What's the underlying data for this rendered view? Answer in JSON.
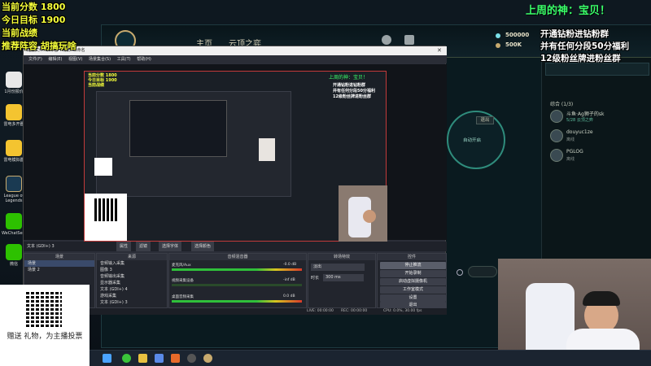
{
  "overlay_left": {
    "score": "当前分数 1800",
    "target": "今日目标 1900",
    "record": "当前战绩",
    "recommend": "推荐阵容 胡搞玩啥"
  },
  "overlay_god": "上周的神：宝贝！",
  "overlay_right": {
    "line1": "开通钻粉进钻粉群",
    "line2": "并有任何分段50分福利",
    "line3": "12级粉丝牌进粉丝群"
  },
  "lol_client": {
    "nav_home": "主页",
    "nav_tft": "云顶之弈",
    "currency_1": "500000",
    "currency_2": "500K",
    "friends_header": "综合 (1/3)",
    "friends": [
      {
        "name": "斗鱼·Ag狮子的sk",
        "status": "5/28 云顶之弈"
      },
      {
        "name": "douyuc1ze",
        "status": "离线"
      },
      {
        "name": "PGLOG",
        "status": "离线"
      }
    ],
    "button_exit": "退出",
    "mode_label": "自动开启"
  },
  "obs": {
    "title": "配置文件: 未命名 - 场景: 未命名",
    "menu": [
      "文件(F)",
      "编辑(E)",
      "视图(V)",
      "场景集合(S)",
      "工具(T)",
      "帮助(H)"
    ],
    "source_name": "文本 (GDI+) 3",
    "toolbar_props": "属性",
    "toolbar_filters": "滤镜",
    "toolbar_text": "选择字体",
    "toolbar_edit": "选择颜色",
    "scenes_header": "场景",
    "scenes": [
      "场景",
      "场景 2"
    ],
    "sources_header": "来源",
    "sources": [
      "音频输入采集",
      "图像 3",
      "音频输出采集",
      "显示器采集",
      "文本 (GDI+) 4",
      "游戏采集",
      "文本 (GDI+) 3"
    ],
    "mixer_header": "音频混音器",
    "mixer": [
      {
        "name": "麦克风/Aux",
        "db": "-0.0 dB"
      },
      {
        "name": "视频采集设备",
        "db": "-inf dB"
      },
      {
        "name": "桌面音频采集",
        "db": "0.0 dB"
      }
    ],
    "transitions_header": "转场特效",
    "transition_value": "淡出",
    "duration_label": "时长",
    "duration_value": "300 ms",
    "controls_header": "控件",
    "controls": [
      "停止推流",
      "开始录制",
      "启动虚拟摄像机",
      "工作室模式",
      "设置",
      "退出"
    ],
    "status_live": "LIVE: 00:00:00",
    "status_rec": "REC: 00:00:00",
    "status_cpu": "CPU: 0.0%, 30.00 fps"
  },
  "qr_caption": "赠送 礼物，为主播投票",
  "qr_caption2": "为主播投票",
  "colors": {
    "overlay_yellow": "#f6ff3a",
    "god_green": "#3aff6a",
    "obs_bg": "#2b2e38",
    "lol_gold": "#c8aa6e"
  }
}
